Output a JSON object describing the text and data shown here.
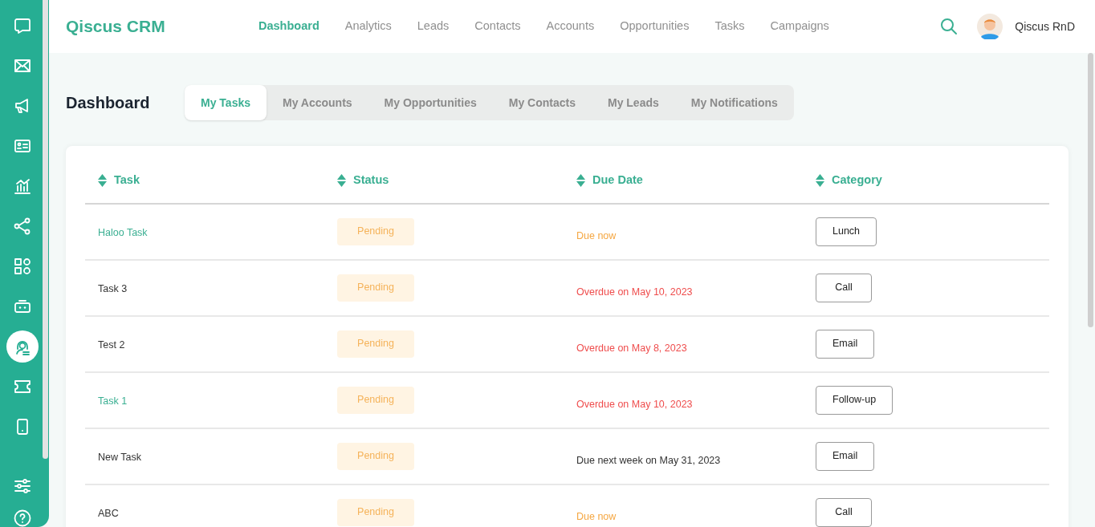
{
  "sidebar": {
    "items": [
      {
        "selected": false
      },
      {
        "selected": false
      },
      {
        "selected": false
      },
      {
        "selected": false
      },
      {
        "selected": false
      },
      {
        "selected": false
      },
      {
        "selected": false
      },
      {
        "selected": false
      },
      {
        "selected": true
      },
      {
        "selected": false
      },
      {
        "selected": false
      },
      {
        "selected": false
      },
      {
        "selected": false
      }
    ]
  },
  "header": {
    "brand": "Qiscus CRM",
    "nav": [
      {
        "label": "Dashboard",
        "selected": true
      },
      {
        "label": "Analytics",
        "selected": false
      },
      {
        "label": "Leads",
        "selected": false
      },
      {
        "label": "Contacts",
        "selected": false
      },
      {
        "label": "Accounts",
        "selected": false
      },
      {
        "label": "Opportunities",
        "selected": false
      },
      {
        "label": "Tasks",
        "selected": false
      },
      {
        "label": "Campaigns",
        "selected": false
      }
    ],
    "user": "Qiscus RnD"
  },
  "page_title": "Dashboard",
  "tabs": [
    {
      "label": "My Tasks",
      "selected": true
    },
    {
      "label": "My Accounts",
      "selected": false
    },
    {
      "label": "My Opportunities",
      "selected": false
    },
    {
      "label": "My Contacts",
      "selected": false
    },
    {
      "label": "My Leads",
      "selected": false
    },
    {
      "label": "My Notifications",
      "selected": false
    }
  ],
  "table": {
    "columns": [
      "Task",
      "Status",
      "Due Date",
      "Category"
    ],
    "rows": [
      {
        "task": "Haloo Task",
        "highlighted": true,
        "status": "Pending",
        "due": "Due now",
        "color": "#f5a742",
        "category": "Lunch"
      },
      {
        "task": "Task 3",
        "highlighted": false,
        "status": "Pending",
        "due": "Overdue on May 10, 2023",
        "color": "#ef4d4d",
        "category": "Call"
      },
      {
        "task": "Test 2",
        "highlighted": false,
        "status": "Pending",
        "due": "Overdue on May 8, 2023",
        "color": "#ef4d4d",
        "category": "Email"
      },
      {
        "task": "Task 1",
        "highlighted": true,
        "status": "Pending",
        "due": "Overdue on May 10, 2023",
        "color": "#ef4d4d",
        "category": "Follow-up"
      },
      {
        "task": "New Task",
        "highlighted": false,
        "status": "Pending",
        "due": "Due next week on May 31, 2023",
        "color": "#333333",
        "category": "Email"
      },
      {
        "task": "ABC",
        "highlighted": false,
        "status": "Pending",
        "due": "Due now",
        "color": "#f5a742",
        "category": "Call"
      }
    ]
  }
}
